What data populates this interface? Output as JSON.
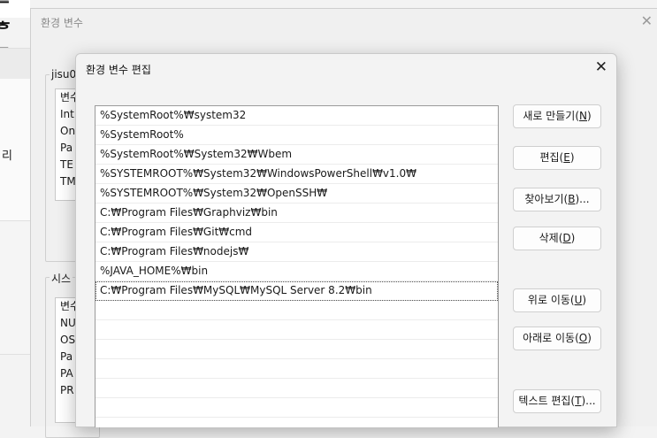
{
  "background": {
    "big_title": "ᄅ ᄒ ᄃ ᄆ",
    "side_label": "리"
  },
  "env_window": {
    "title": "환경 변수",
    "user_group_label": "jisu0",
    "user_vars": [
      "변수",
      "Int",
      "On",
      "Pa",
      "TE",
      "TM"
    ],
    "system_group_label": "시스",
    "system_vars": [
      "변수",
      "NU",
      "OS",
      "Pa",
      "PA",
      "PR"
    ]
  },
  "edit_dialog": {
    "title": "환경 변수 편집",
    "paths": [
      "%SystemRoot%₩system32",
      "%SystemRoot%",
      "%SystemRoot%₩System32₩Wbem",
      "%SYSTEMROOT%₩System32₩WindowsPowerShell₩v1.0₩",
      "%SYSTEMROOT%₩System32₩OpenSSH₩",
      "C:₩Program Files₩Graphviz₩bin",
      "C:₩Program Files₩Git₩cmd",
      "C:₩Program Files₩nodejs₩",
      "%JAVA_HOME%₩bin",
      "C:₩Program Files₩MySQL₩MySQL Server 8.2₩bin",
      "",
      "",
      "",
      "",
      "",
      "",
      ""
    ],
    "selected_index": 9,
    "buttons": {
      "new": {
        "label": "새로 만들기(",
        "key": "N",
        "end": ")"
      },
      "edit": {
        "label": "편집(",
        "key": "E",
        "end": ")"
      },
      "browse": {
        "label": "찾아보기(",
        "key": "B",
        "end": ")..."
      },
      "delete": {
        "label": "삭제(",
        "key": "D",
        "end": ")"
      },
      "move_up": {
        "label": "위로 이동(",
        "key": "U",
        "end": ")"
      },
      "move_down": {
        "label": "아래로 이동(",
        "key": "O",
        "end": ")"
      },
      "edit_text": {
        "label": "텍스트 편집(",
        "key": "T",
        "end": ")..."
      }
    }
  }
}
